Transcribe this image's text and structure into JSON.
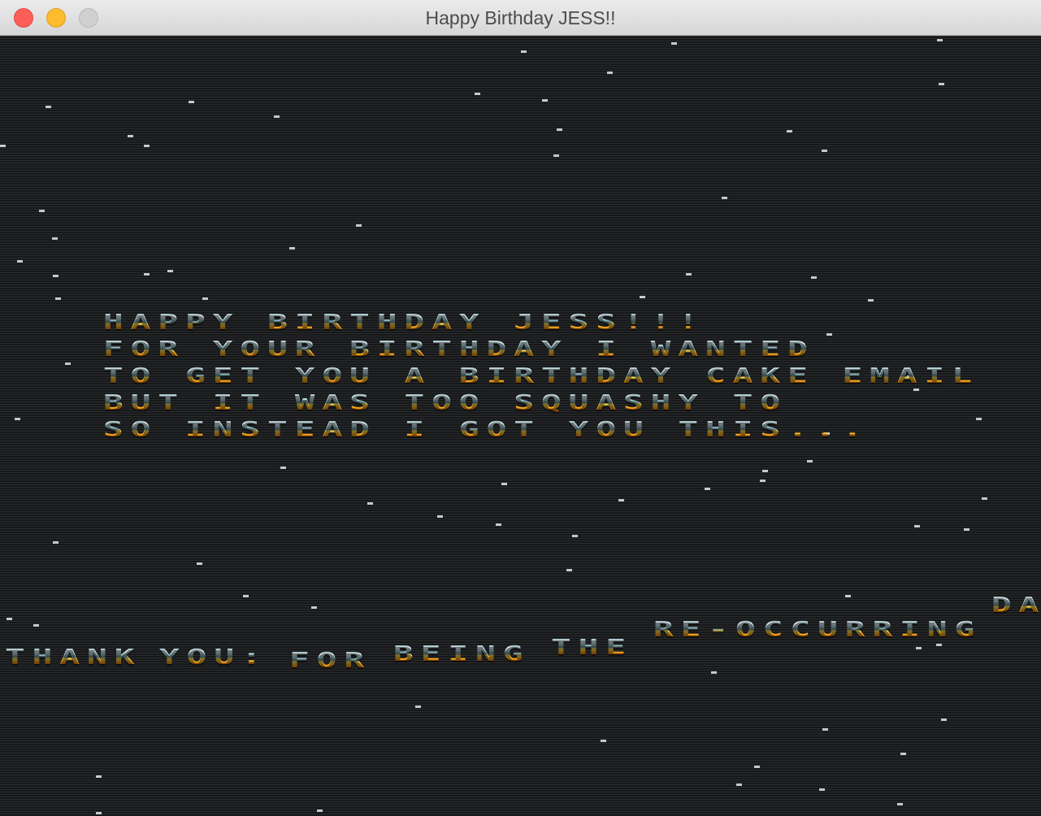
{
  "window": {
    "title": "Happy Birthday JESS!!"
  },
  "demo": {
    "message_lines": [
      "HAPPY BIRTHDAY JESS!!!",
      "FOR YOUR BIRTHDAY I WANTED",
      "TO GET YOU A BIRTHDAY CAKE EMAIL",
      "BUT IT WAS TOO SQUASHY TO",
      "SO INSTEAD I GOT YOU THIS..."
    ],
    "scroller_words": [
      "THANK",
      "YOU:",
      "FOR",
      "BEING",
      "THE",
      "RE-OCCURRING",
      "DA"
    ],
    "colors": {
      "background": "#1e1f21",
      "scanline": "#17181a",
      "star": "#c9c9c9",
      "chrome_top": "#eaf6f7",
      "chrome_bottom": "#ffab1a"
    }
  }
}
